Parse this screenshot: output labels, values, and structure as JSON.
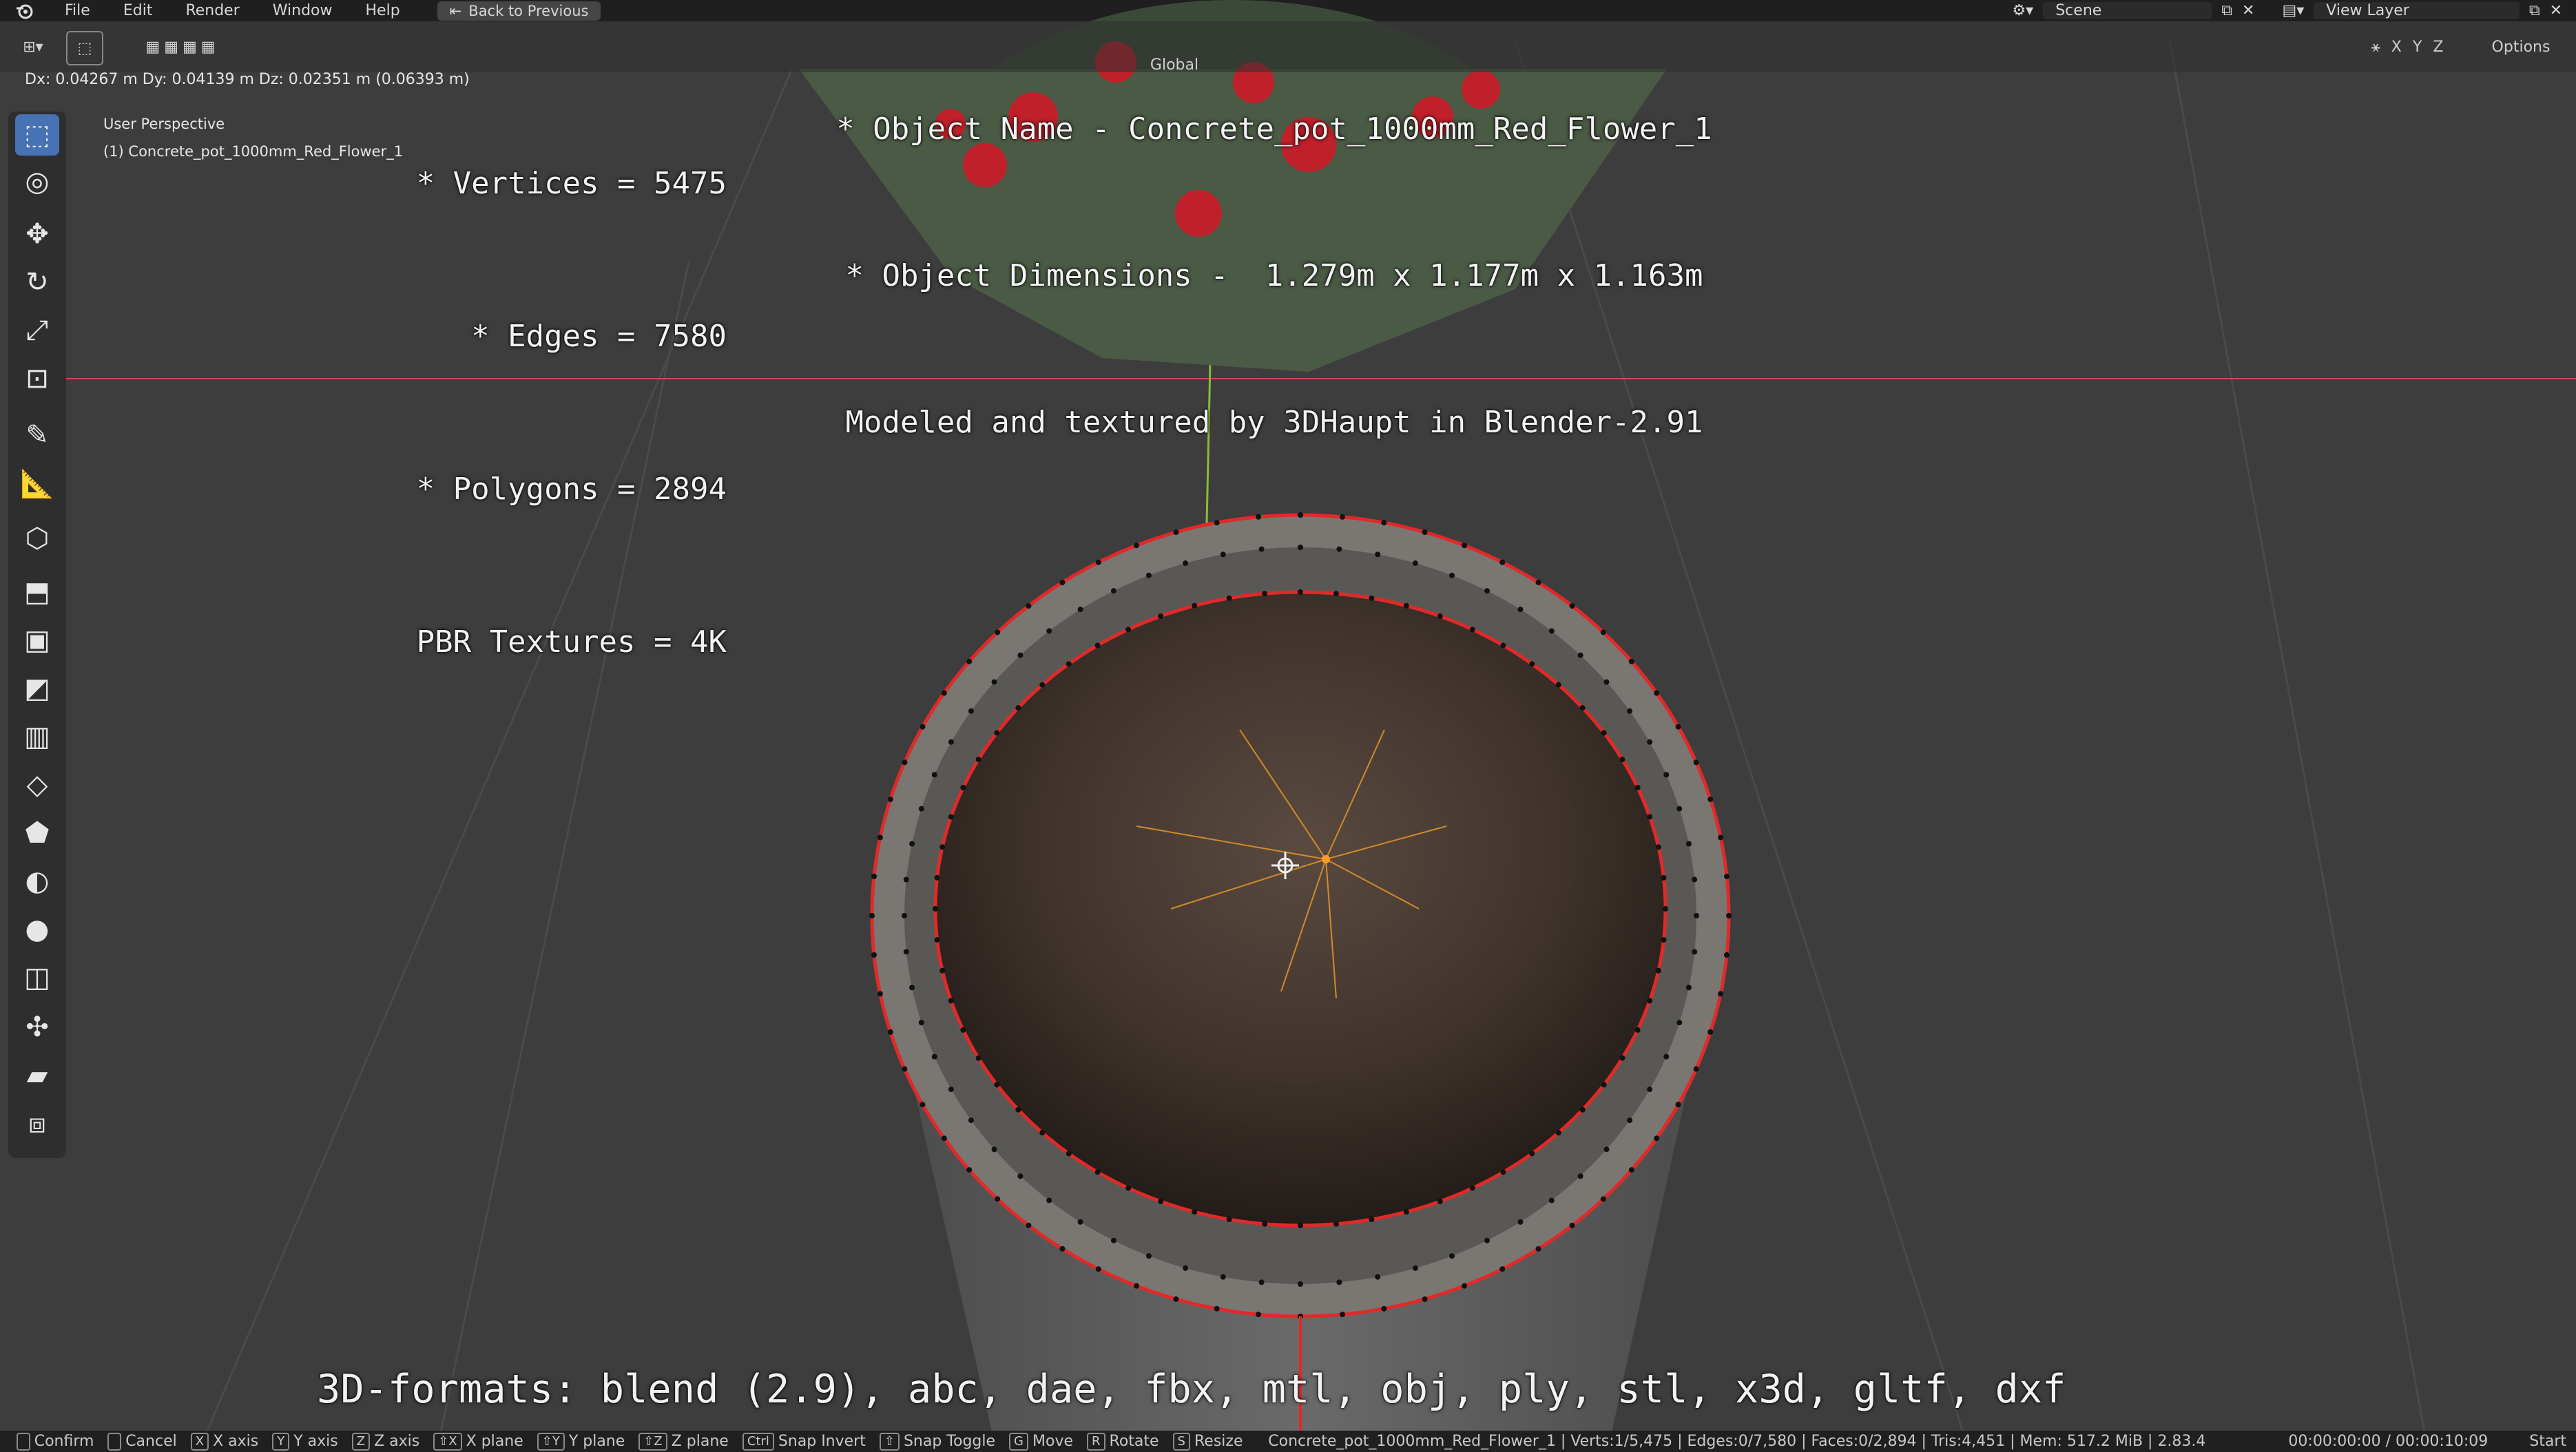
{
  "topbar": {
    "menus": [
      "File",
      "Edit",
      "Render",
      "Window",
      "Help"
    ],
    "back_button": "Back to Previous",
    "scene": "Scene",
    "view_layer": "View Layer"
  },
  "header": {
    "orientation": "Global",
    "axes": [
      "X",
      "Y",
      "Z"
    ],
    "options": "Options"
  },
  "transform_readout": "Dx: 0.04267 m  Dy: 0.04139 m  Dz: 0.02351 m (0.06393 m)",
  "viewport": {
    "perspective": "User Perspective",
    "object_label": "(1) Concrete_pot_1000mm_Red_Flower_1"
  },
  "stats_overlay": {
    "vertices": "* Vertices = 5475",
    "edges": "* Edges = 7580",
    "polygons": "* Polygons = 2894",
    "textures": "PBR Textures = 4K"
  },
  "info_overlay": {
    "name": "* Object Name - Concrete_pot_1000mm_Red_Flower_1",
    "dimensions": "* Object Dimensions -  1.279m x 1.177m x 1.163m",
    "credit": "Modeled and textured by 3DHaupt in Blender-2.91"
  },
  "formats_overlay": "3D-formats: blend (2.9), abc, dae, fbx, mtl, obj, ply, stl, x3d, gltf, dxf",
  "statusbar": {
    "items": [
      {
        "key": "",
        "label": "Confirm"
      },
      {
        "key": "",
        "label": "Cancel"
      },
      {
        "key": "X",
        "label": "X axis"
      },
      {
        "key": "Y",
        "label": "Y axis"
      },
      {
        "key": "Z",
        "label": "Z axis"
      },
      {
        "key": "⇧X",
        "label": "X plane"
      },
      {
        "key": "⇧Y",
        "label": "Y plane"
      },
      {
        "key": "⇧Z",
        "label": "Z plane"
      },
      {
        "key": "Ctrl",
        "label": "Snap Invert"
      },
      {
        "key": "⇧",
        "label": "Snap Toggle"
      },
      {
        "key": "G",
        "label": "Move"
      },
      {
        "key": "R",
        "label": "Rotate"
      },
      {
        "key": "S",
        "label": "Resize"
      }
    ],
    "scene_stats": "Concrete_pot_1000mm_Red_Flower_1 | Verts:1/5,475 | Edges:0/7,580 | Faces:0/2,894 | Tris:4,451 | Mem: 517.2 MiB | 2.83.4",
    "timecode": "00:00:00:00 / 00:00:10:09",
    "start": "Start"
  },
  "colors": {
    "accent": "#4772b3",
    "edge_highlight": "#e02a2a",
    "x_axis": "#c94a55",
    "y_axis": "#7fbf3a"
  }
}
